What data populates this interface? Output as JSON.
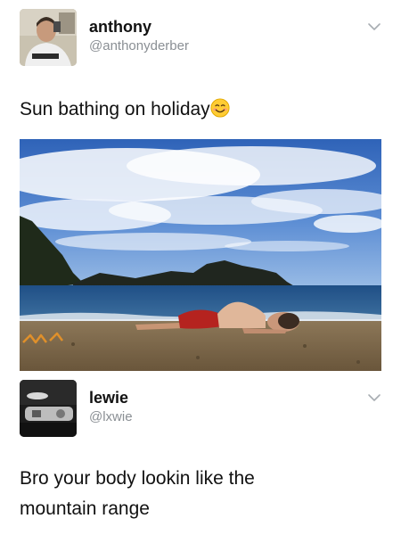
{
  "tweet1": {
    "display_name": "anthony",
    "handle": "@anthonyderber",
    "text": "Sun bathing on holiday",
    "emoji_icon": "smiling-face-emoji-icon",
    "photo": "beach-photo"
  },
  "tweet2": {
    "display_name": "lewie",
    "handle": "@lxwie",
    "text_line1": "Bro your body lookin like the",
    "text_line2": "mountain range"
  },
  "colors": {
    "handle": "#8a8f94",
    "text": "#111111",
    "chevron": "#a8adb2"
  }
}
